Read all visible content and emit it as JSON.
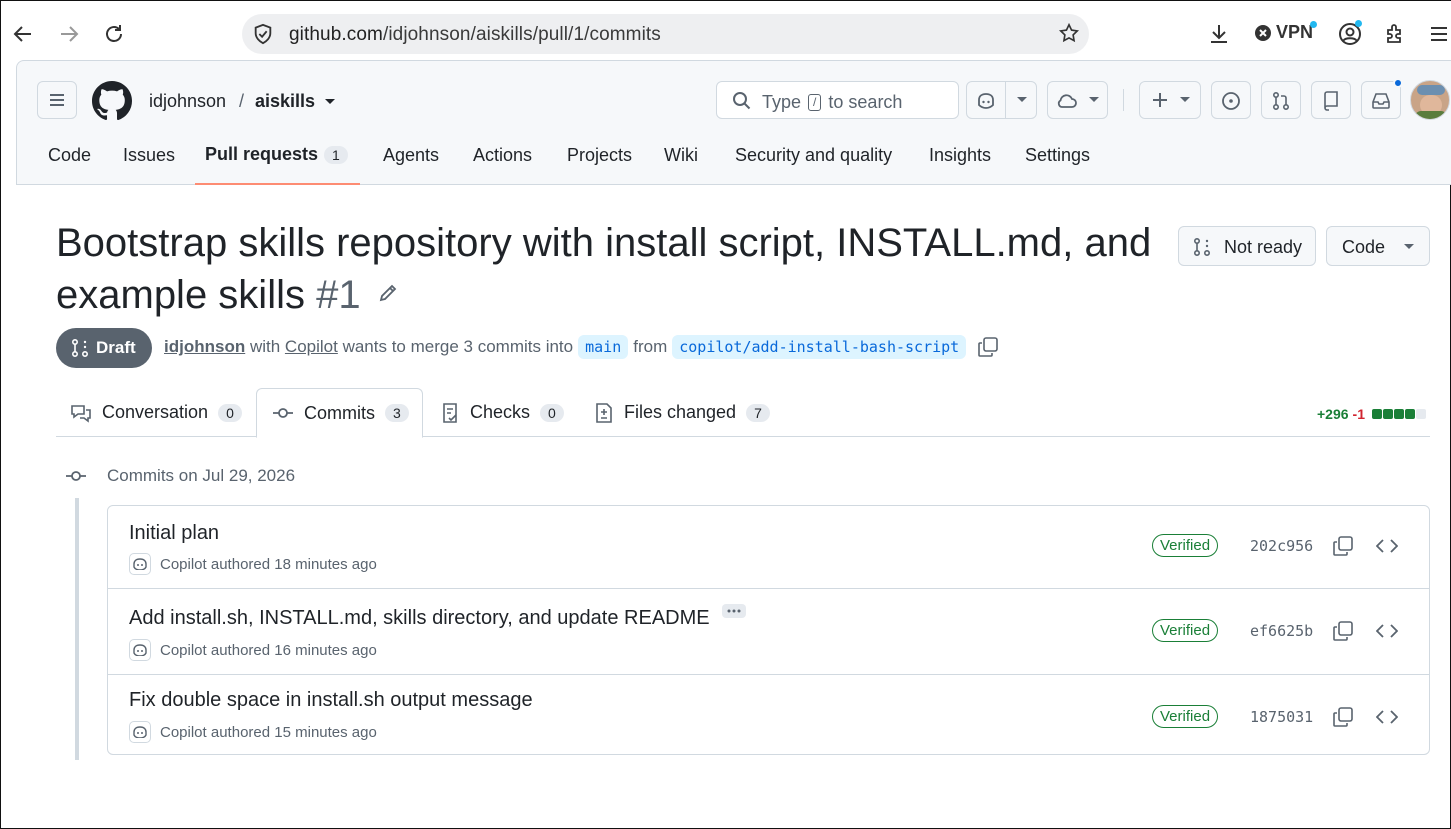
{
  "browser": {
    "url_host": "github.com",
    "url_path": "/idjohnson/aiskills/pull/1/commits",
    "vpn_label": "VPN"
  },
  "header": {
    "owner": "idjohnson",
    "slash": "/",
    "repo": "aiskills",
    "search_pre": "Type",
    "search_key": "/",
    "search_post": "to search"
  },
  "nav": {
    "code": "Code",
    "issues": "Issues",
    "pulls": "Pull requests",
    "pulls_count": "1",
    "agents": "Agents",
    "actions": "Actions",
    "projects": "Projects",
    "wiki": "Wiki",
    "security": "Security and quality",
    "insights": "Insights",
    "settings": "Settings"
  },
  "pr": {
    "title": "Bootstrap skills repository with install script, INSTALL.md, and example skills",
    "number": "#1",
    "not_ready": "Not ready",
    "code": "Code",
    "draft": "Draft",
    "author": "idjohnson",
    "with": "with",
    "coauthor": "Copilot",
    "merge_text": "wants to merge 3 commits into",
    "base": "main",
    "from": "from",
    "head": "copilot/add-install-bash-script"
  },
  "tabs": {
    "conversation": "Conversation",
    "conversation_count": "0",
    "commits": "Commits",
    "commits_count": "3",
    "checks": "Checks",
    "checks_count": "0",
    "files": "Files changed",
    "files_count": "7"
  },
  "diffstat": {
    "additions": "+296",
    "deletions": "-1"
  },
  "commits": {
    "group_label": "Commits on Jul 29, 2026",
    "items": [
      {
        "title": "Initial plan",
        "author": "Copilot",
        "action": "authored",
        "time": "18 minutes ago",
        "badge": "Verified",
        "sha": "202c956"
      },
      {
        "title": "Add install.sh, INSTALL.md, skills directory, and update README",
        "author": "Copilot",
        "action": "authored",
        "time": "16 minutes ago",
        "badge": "Verified",
        "sha": "ef6625b"
      },
      {
        "title": "Fix double space in install.sh output message",
        "author": "Copilot",
        "action": "authored",
        "time": "15 minutes ago",
        "badge": "Verified",
        "sha": "1875031"
      }
    ]
  },
  "colors": {
    "accent": "#fd8c73",
    "verified": "#1a7f37",
    "branch_bg": "#ddf4ff",
    "link": "#0969da"
  }
}
